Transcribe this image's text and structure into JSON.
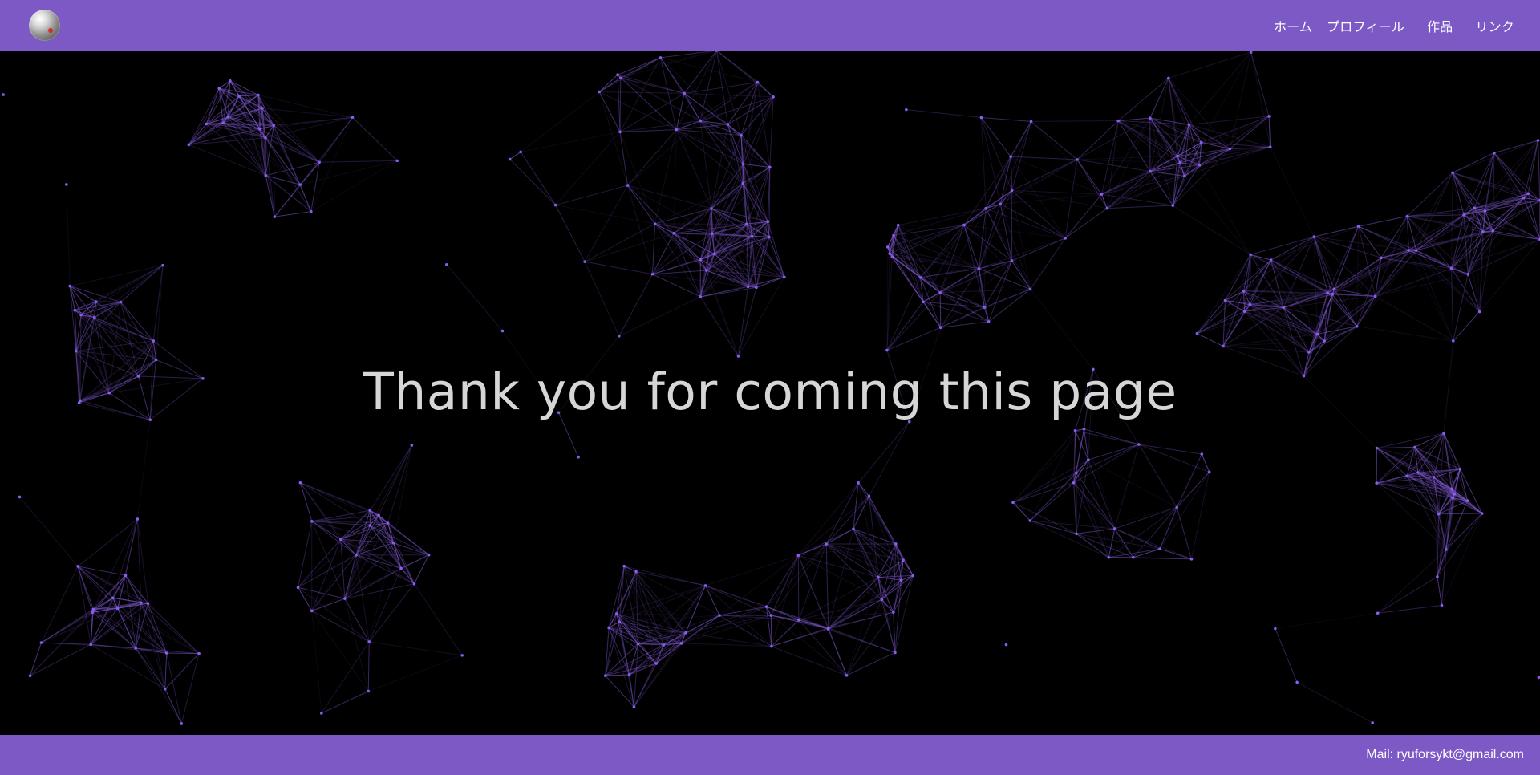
{
  "theme": {
    "accent": "#7c59c4",
    "background": "#000000",
    "network_line": "#7a55c8",
    "network_node": "#8a5cf0",
    "title_color": "#d6d6d6"
  },
  "header": {
    "logo_icon": "orb-logo-icon",
    "nav": [
      {
        "label": "ホーム"
      },
      {
        "label": "プロフィール"
      },
      {
        "label": "作品"
      },
      {
        "label": "リンク"
      }
    ]
  },
  "main": {
    "background_effect": "particle-network",
    "title": "Thank you for coming this page"
  },
  "footer": {
    "mail": "Mail: ryuforsykt@gmail.com"
  }
}
